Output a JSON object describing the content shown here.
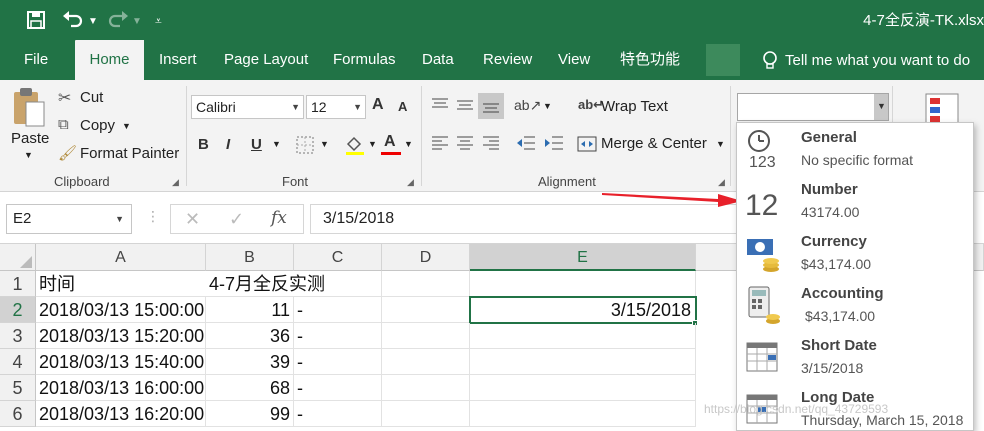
{
  "window": {
    "title": "4-7全反演-TK.xlsx"
  },
  "quick_access": {
    "save": "save-icon",
    "undo": "undo-icon",
    "redo": "redo-icon",
    "customize": "customize-icon"
  },
  "tabs": [
    {
      "label": "File"
    },
    {
      "label": "Home"
    },
    {
      "label": "Insert"
    },
    {
      "label": "Page Layout"
    },
    {
      "label": "Formulas"
    },
    {
      "label": "Data"
    },
    {
      "label": "Review"
    },
    {
      "label": "View"
    },
    {
      "label": "特色功能"
    }
  ],
  "tell_me": "Tell me what you want to do",
  "clipboard": {
    "paste": "Paste",
    "cut": "Cut",
    "copy": "Copy",
    "format_painter": "Format Painter",
    "group": "Clipboard"
  },
  "font": {
    "name": "Calibri",
    "size": "12",
    "bold": "B",
    "italic": "I",
    "underline": "U",
    "font_color": "A",
    "grow": "A",
    "shrink": "A",
    "group": "Font"
  },
  "alignment": {
    "wrap_text": "Wrap Text",
    "merge_center": "Merge & Center",
    "group": "Alignment"
  },
  "formula_bar": {
    "name_box": "E2",
    "fx": "fx",
    "value": "3/15/2018"
  },
  "columns": [
    "A",
    "B",
    "C",
    "D",
    "E"
  ],
  "rows": [
    {
      "n": "1",
      "a": "时间",
      "b": "4-7月全反实测",
      "c": "",
      "e": ""
    },
    {
      "n": "2",
      "a": "2018/03/13 15:00:00",
      "b": "11",
      "c": "-",
      "e": "3/15/2018"
    },
    {
      "n": "3",
      "a": "2018/03/13 15:20:00",
      "b": "36",
      "c": "-",
      "e": ""
    },
    {
      "n": "4",
      "a": "2018/03/13 15:40:00",
      "b": "39",
      "c": "-",
      "e": ""
    },
    {
      "n": "5",
      "a": "2018/03/13 16:00:00",
      "b": "68",
      "c": "-",
      "e": ""
    },
    {
      "n": "6",
      "a": "2018/03/13 16:20:00",
      "b": "99",
      "c": "-",
      "e": ""
    }
  ],
  "number_formats": [
    {
      "name": "General",
      "example": "No specific format",
      "icon": "clock-123-icon"
    },
    {
      "name": "Number",
      "example": "43174.00",
      "icon": "number-12-icon"
    },
    {
      "name": "Currency",
      "example": "$43,174.00",
      "icon": "currency-icon"
    },
    {
      "name": "Accounting",
      "example": "$43,174.00",
      "icon": "calculator-icon"
    },
    {
      "name": "Short Date",
      "example": "3/15/2018",
      "icon": "calendar-icon"
    },
    {
      "name": "Long Date",
      "example": "Thursday, March 15, 2018",
      "icon": "calendar-icon"
    }
  ],
  "colors": {
    "excel_green": "#217346",
    "arrow_red": "#e8202a",
    "selection_green": "#217346"
  },
  "watermark": "https://blog.csdn.net/qq_43729593"
}
